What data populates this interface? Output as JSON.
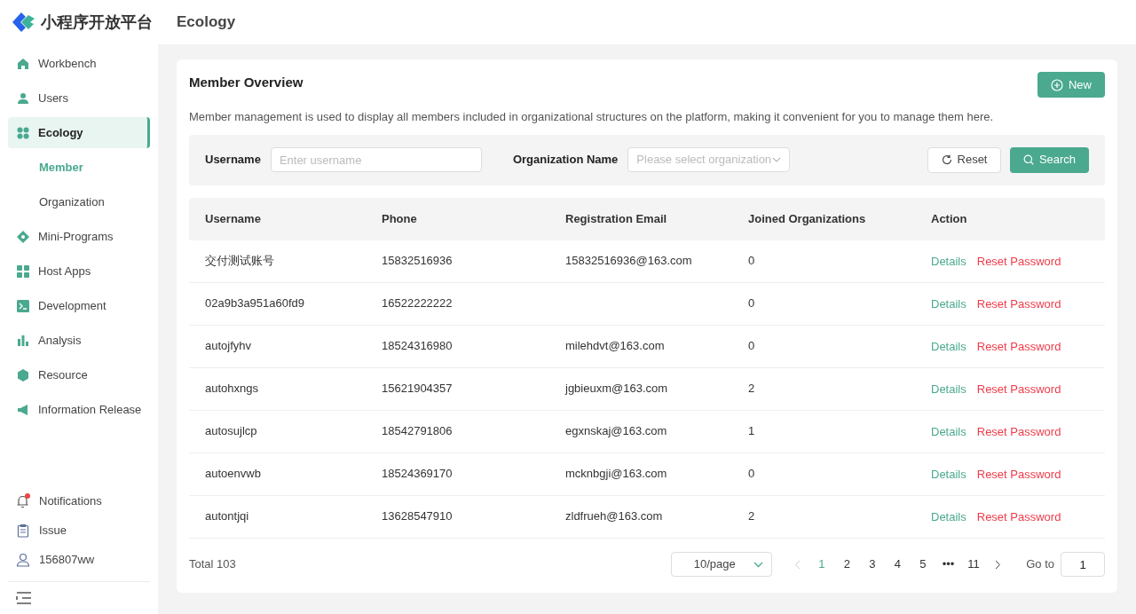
{
  "logo": {
    "text": "小程序开放平台"
  },
  "sidebar": {
    "items": [
      {
        "label": "Workbench",
        "selected": false
      },
      {
        "label": "Users",
        "selected": false
      },
      {
        "label": "Ecology",
        "selected": true,
        "children": [
          {
            "label": "Member",
            "selected": true
          },
          {
            "label": "Organization",
            "selected": false
          }
        ]
      },
      {
        "label": "Mini-Programs",
        "selected": false
      },
      {
        "label": "Host Apps",
        "selected": false
      },
      {
        "label": "Development",
        "selected": false
      },
      {
        "label": "Analysis",
        "selected": false
      },
      {
        "label": "Resource",
        "selected": false
      },
      {
        "label": "Information Release",
        "selected": false
      }
    ],
    "footer_items": [
      {
        "label": "Notifications",
        "unread": true
      },
      {
        "label": "Issue",
        "unread": false
      },
      {
        "label": "156807ww",
        "unread": false
      }
    ]
  },
  "header": {
    "title": "Ecology"
  },
  "card": {
    "title": "Member Overview",
    "new_button": "New",
    "description": "Member management is used to display all members included in organizational structures on the platform, making it convenient for you to manage them here."
  },
  "filters": {
    "username_label": "Username",
    "username_placeholder": "Enter username",
    "org_label": "Organization Name",
    "org_placeholder": "Please select organization",
    "reset_button": "Reset",
    "search_button": "Search"
  },
  "table": {
    "columns": [
      "Username",
      "Phone",
      "Registration Email",
      "Joined Organizations",
      "Action"
    ],
    "rows": [
      {
        "username": "交付测试账号",
        "phone": "15832516936",
        "email": "15832516936@163.com",
        "joined": "0",
        "details": "Details",
        "reset": "Reset Password"
      },
      {
        "username": "02a9b3a951a60fd9",
        "phone": "16522222222",
        "email": "",
        "joined": "0",
        "details": "Details",
        "reset": "Reset Password"
      },
      {
        "username": "autojfyhv",
        "phone": "18524316980",
        "email": "milehdvt@163.com",
        "joined": "0",
        "details": "Details",
        "reset": "Reset Password"
      },
      {
        "username": "autohxngs",
        "phone": "15621904357",
        "email": "jgbieuxm@163.com",
        "joined": "2",
        "details": "Details",
        "reset": "Reset Password"
      },
      {
        "username": "autosujlcp",
        "phone": "18542791806",
        "email": "egxnskaj@163.com",
        "joined": "1",
        "details": "Details",
        "reset": "Reset Password"
      },
      {
        "username": "autoenvwb",
        "phone": "18524369170",
        "email": "mcknbgji@163.com",
        "joined": "0",
        "details": "Details",
        "reset": "Reset Password"
      },
      {
        "username": "autontjqi",
        "phone": "13628547910",
        "email": "zldfrueh@163.com",
        "joined": "2",
        "details": "Details",
        "reset": "Reset Password"
      }
    ]
  },
  "pagination": {
    "total": "Total 103",
    "page_size": "10/page",
    "pages": [
      {
        "label": "1",
        "selected": true
      },
      {
        "label": "2",
        "selected": false
      },
      {
        "label": "3",
        "selected": false
      },
      {
        "label": "4",
        "selected": false
      },
      {
        "label": "5",
        "selected": false
      },
      {
        "label": "•••",
        "selected": false
      },
      {
        "label": "11",
        "selected": false
      }
    ],
    "goto_label": "Go to",
    "goto_value": "1"
  }
}
